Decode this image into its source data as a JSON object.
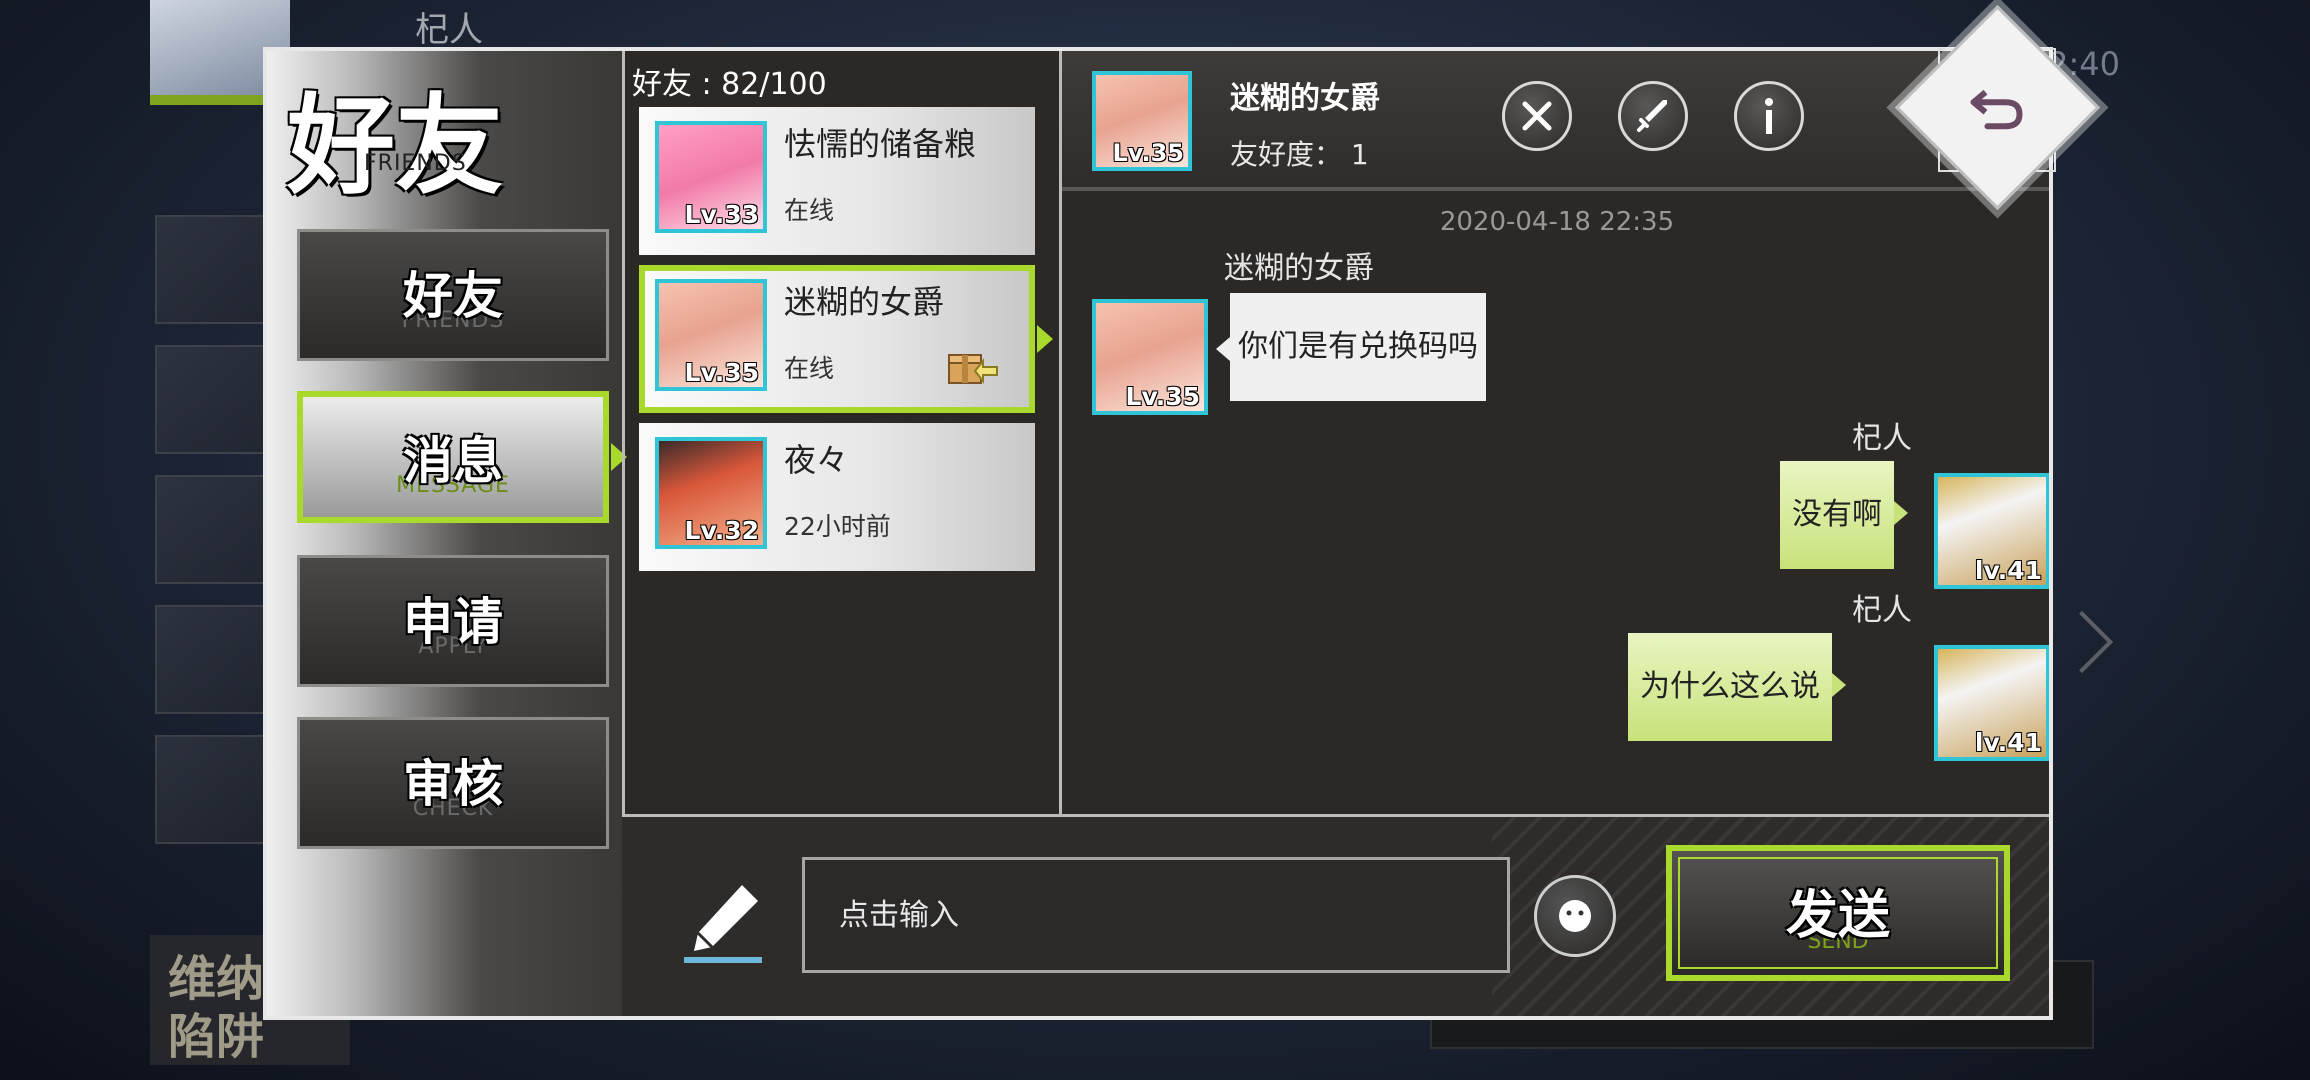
{
  "background": {
    "player_name": "杞人",
    "time": "2:40",
    "venus_text_1": "维纳",
    "venus_text_2": "陷阱"
  },
  "nav": {
    "title": "好友",
    "title_sub": "FRIENDS",
    "items": [
      {
        "label": "好友",
        "sub": "FRIENDS"
      },
      {
        "label": "消息",
        "sub": "MESSAGE"
      },
      {
        "label": "申请",
        "sub": "APPLY"
      },
      {
        "label": "审核",
        "sub": "CHECK"
      }
    ],
    "active_index": 1
  },
  "friends": {
    "count_label": "好友 : 82/100",
    "list": [
      {
        "name": "怯懦的储备粮",
        "status": "在线",
        "level": "Lv.33",
        "avatar_icon": "pink-hair-avatar-icon"
      },
      {
        "name": "迷糊的女爵",
        "status": "在线",
        "level": "Lv.35",
        "avatar_icon": "peach-hair-avatar-icon",
        "has_gift": true
      },
      {
        "name": "夜々",
        "status": "22小时前",
        "level": "Lv.32",
        "avatar_icon": "pirate-avatar-icon"
      }
    ],
    "selected_index": 1
  },
  "chat": {
    "header": {
      "name": "迷糊的女爵",
      "affinity": "友好度：  1",
      "level": "Lv.35"
    },
    "timestamp": "2020-04-18  22:35",
    "messages": [
      {
        "side": "left",
        "sender": "迷糊的女爵",
        "text": "你们是有兑换码吗",
        "level": "Lv.35"
      },
      {
        "side": "right",
        "sender": "杞人",
        "text": "没有啊",
        "level": "lv.41"
      },
      {
        "side": "right",
        "sender": "杞人",
        "text": "为什么这么说",
        "level": "lv.41"
      }
    ]
  },
  "input": {
    "placeholder": "点击输入",
    "send_label": "发送",
    "send_sub": "SEND"
  },
  "colors": {
    "accent": "#a9d92a",
    "avatar_border": "#2fc4d6",
    "panel": "#2b2826"
  }
}
